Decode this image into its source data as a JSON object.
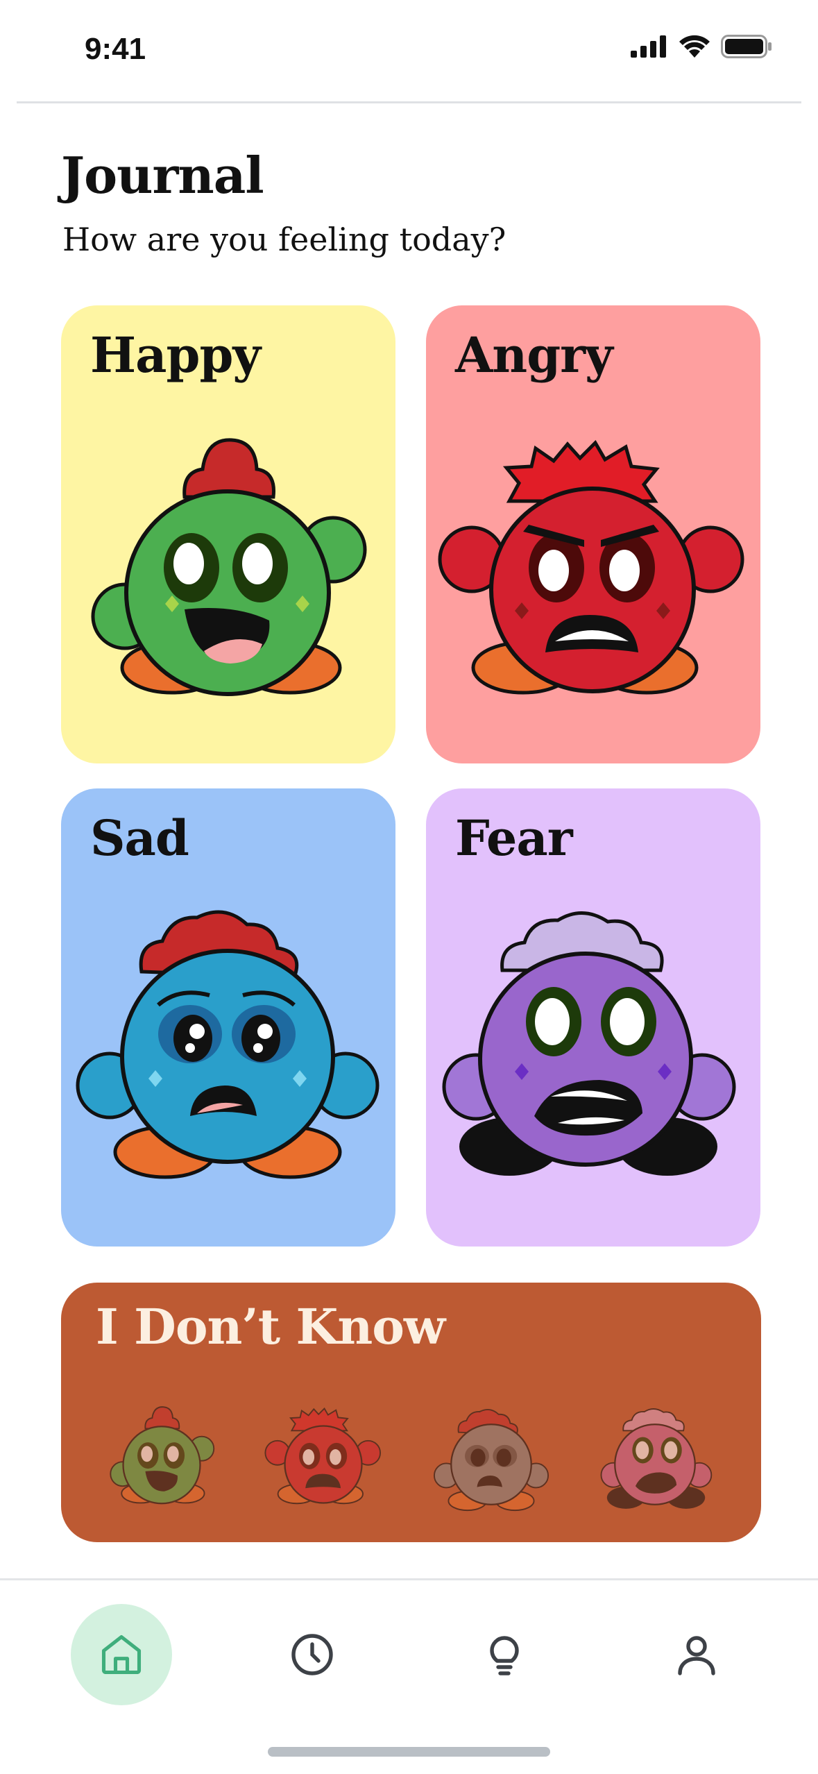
{
  "status_bar": {
    "time": "9:41"
  },
  "header": {
    "title": "Journal",
    "subtitle": "How are you feeling today?"
  },
  "moods": [
    {
      "label": "Happy",
      "bg": "#fef5a3",
      "face": "#4caf50"
    },
    {
      "label": "Angry",
      "bg": "#fe9f9f",
      "face": "#d4202f"
    },
    {
      "label": "Sad",
      "bg": "#9bc3f8",
      "face": "#2a9fcb"
    },
    {
      "label": "Fear",
      "bg": "#e2c1fc",
      "face": "#9966cc"
    }
  ],
  "unknown_card": {
    "label": "I Don’t Know",
    "bg": "#bd5a33"
  },
  "tab_bar": {
    "items": [
      {
        "icon": "home-icon",
        "active": true
      },
      {
        "icon": "clock-icon",
        "active": false
      },
      {
        "icon": "lightbulb-icon",
        "active": false
      },
      {
        "icon": "profile-icon",
        "active": false
      }
    ],
    "accent": "#3fae7c"
  }
}
